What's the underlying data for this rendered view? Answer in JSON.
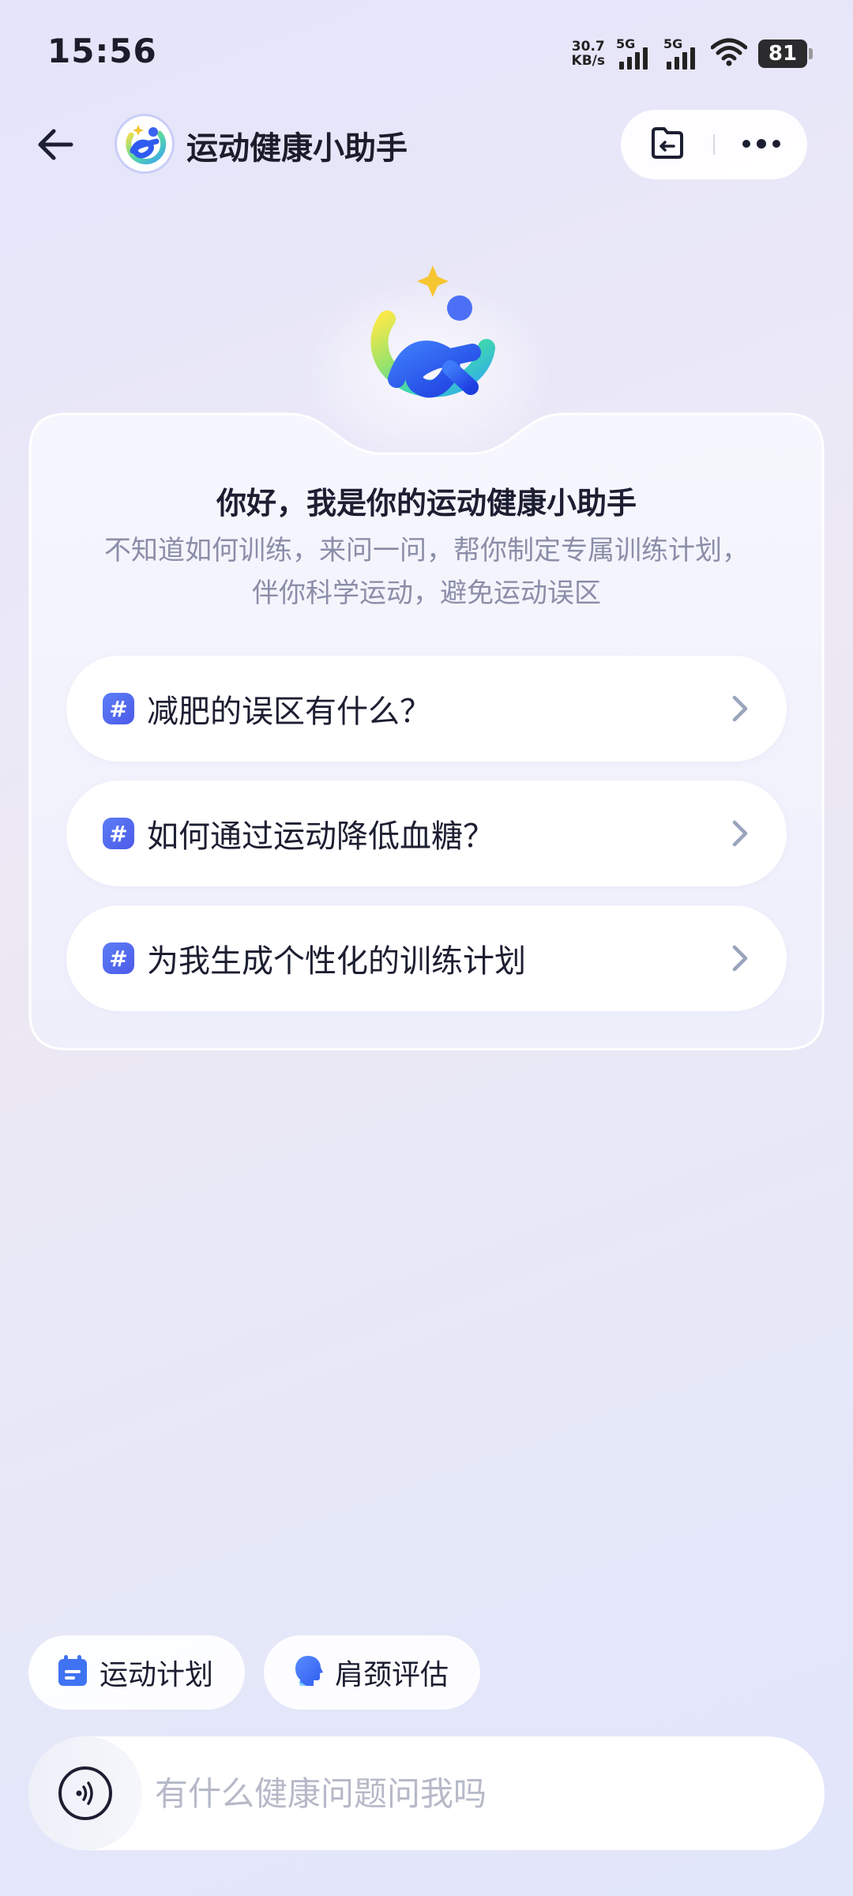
{
  "status_bar": {
    "time": "15:56",
    "net_speed_value": "30.7",
    "net_speed_unit": "KB/s",
    "sim1_label": "5G",
    "sim2_label": "5G",
    "battery_level": "81"
  },
  "header": {
    "title": "运动健康小助手",
    "icons": {
      "back": "back-arrow-icon",
      "history": "history-folder-icon",
      "more": "more-dots-icon"
    }
  },
  "welcome": {
    "title": "你好，我是你的运动健康小助手",
    "subtitle": "不知道如何训练，来问一问，帮你制定专属训练计划，伴你科学运动，避免运动误区"
  },
  "suggestions": [
    {
      "text": "减肥的误区有什么？"
    },
    {
      "text": "如何通过运动降低血糖？"
    },
    {
      "text": "为我生成个性化的训练计划"
    }
  ],
  "suggestion_hash": "#",
  "chips": [
    {
      "label": "运动计划",
      "icon": "calendar-icon"
    },
    {
      "label": "肩颈评估",
      "icon": "head-profile-icon"
    }
  ],
  "input": {
    "placeholder": "有什么健康问题问我吗",
    "value": ""
  },
  "colors": {
    "accent": "#4d5ae8",
    "brand_blue": "#2f5cf0",
    "text_primary": "#1c1e31",
    "text_secondary": "#8a8ea8",
    "placeholder": "#b6b9c8"
  }
}
